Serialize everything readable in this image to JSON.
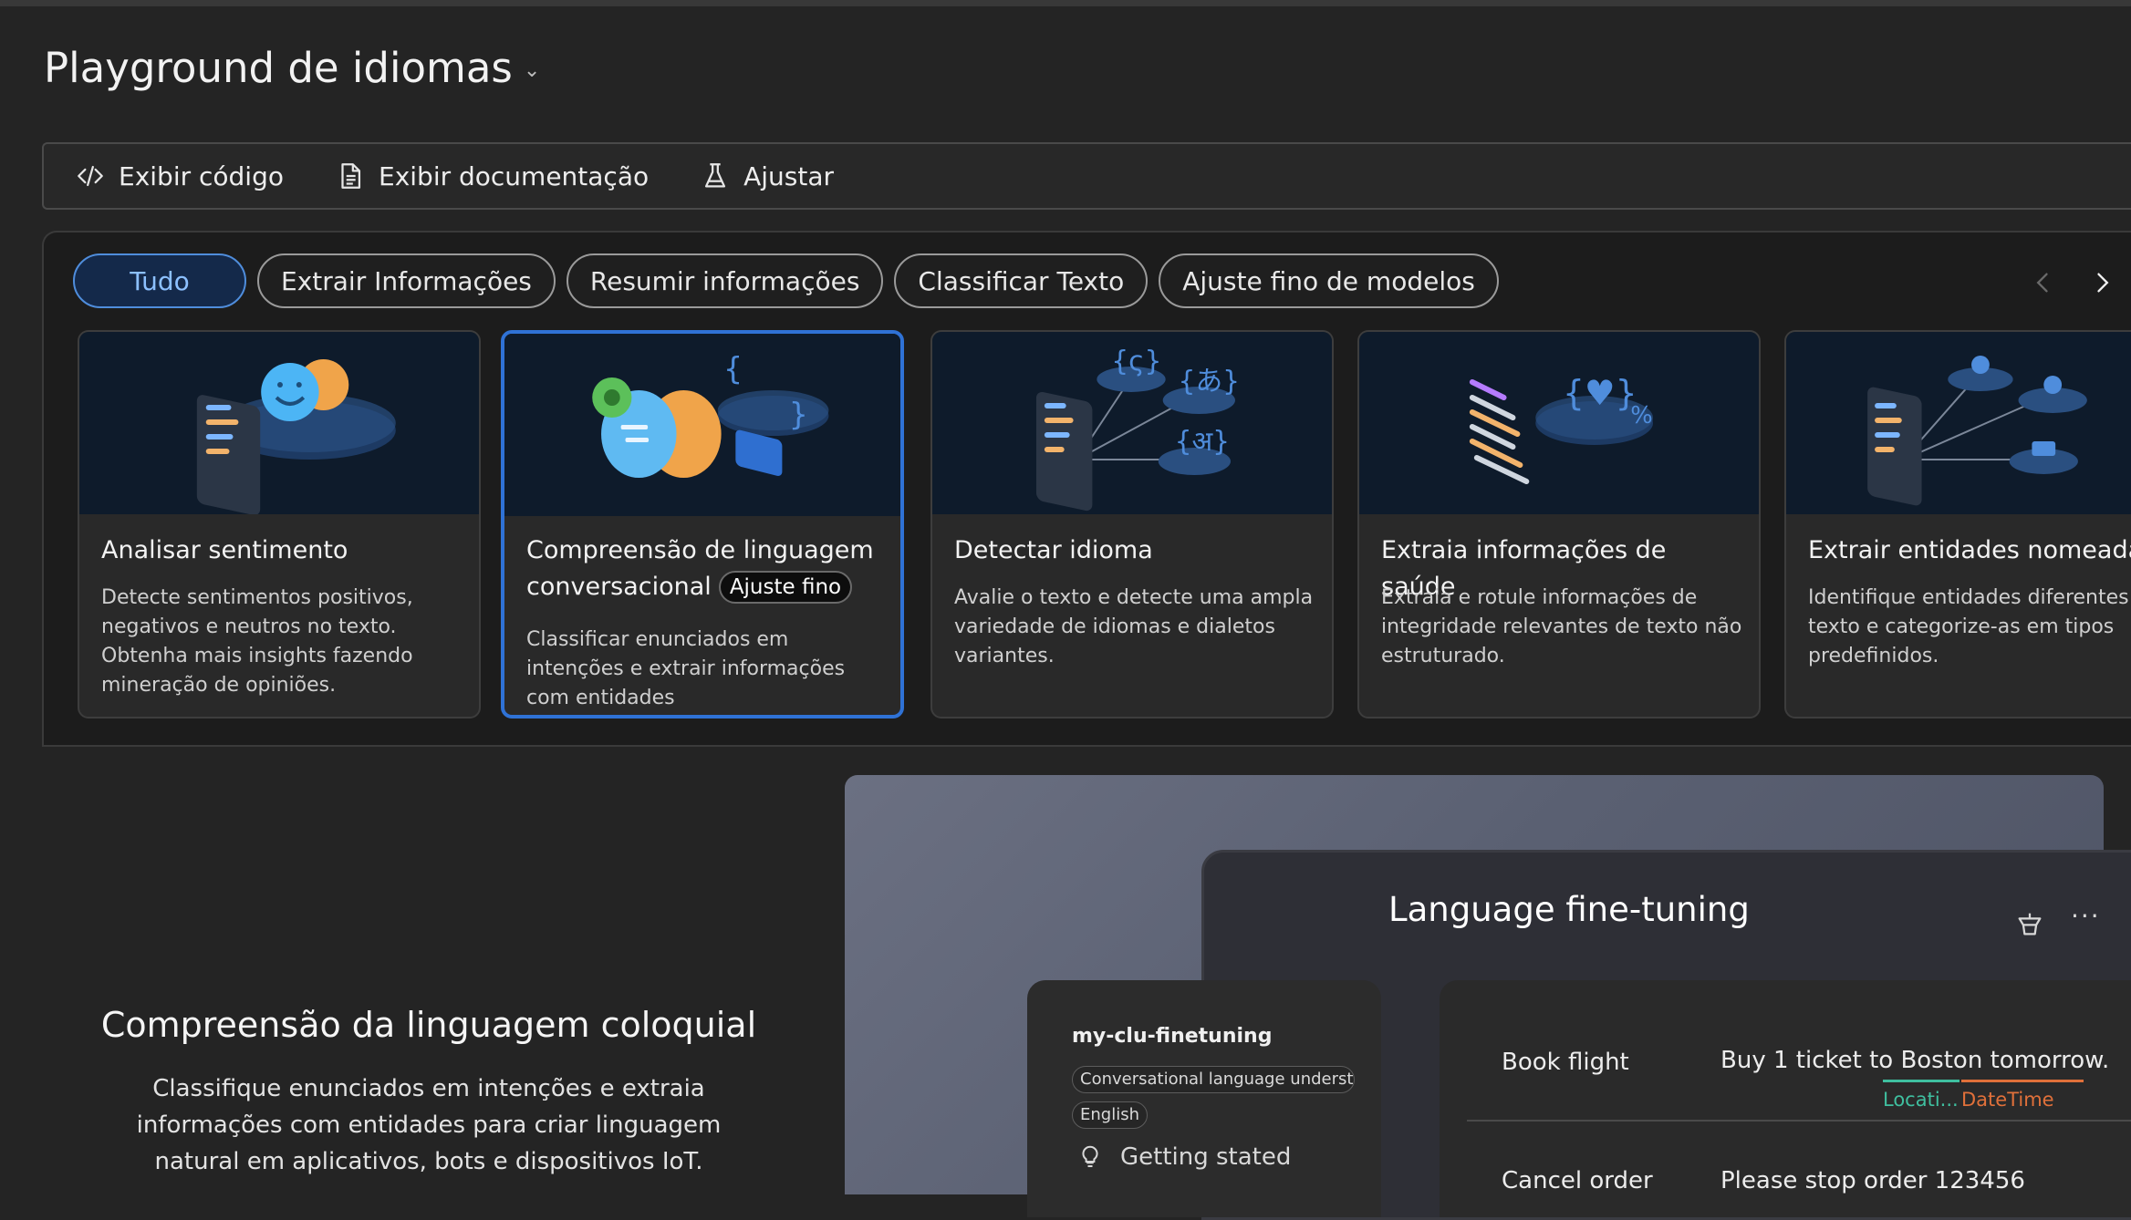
{
  "page": {
    "title": "Playground de idiomas"
  },
  "toolbar": {
    "view_code": "Exibir código",
    "view_docs": "Exibir documentação",
    "tune": "Ajustar"
  },
  "filters": [
    "Tudo",
    "Extrair Informações",
    "Resumir informações",
    "Classificar Texto",
    "Ajuste fino de modelos"
  ],
  "cards": [
    {
      "title": "Analisar sentimento",
      "desc": "Detecte sentimentos positivos, negativos e neutros no texto. Obtenha mais insights fazendo mineração de opiniões."
    },
    {
      "title": "Compreensão de linguagem conversacional",
      "badge": "Ajuste fino",
      "desc": "Classificar enunciados em intenções e extrair informações com entidades"
    },
    {
      "title": "Detectar idioma",
      "desc": "Avalie o texto e detecte uma ampla variedade de idiomas e dialetos variantes."
    },
    {
      "title": "Extraia informações de saúde",
      "desc": "Extraia e rotule informações de integridade relevantes de texto não estruturado."
    },
    {
      "title": "Extrair entidades nomeadas",
      "desc": "Identifique entidades diferentes no texto e categorize-as em tipos predefinidos."
    }
  ],
  "hero": {
    "title": "Compreensão da linguagem coloquial",
    "desc": "Classifique enunciados em intenções e extraia informações com entidades para criar linguagem natural em aplicativos, bots e dispositivos IoT."
  },
  "preview": {
    "title": "Language fine-tuning",
    "more": "···",
    "project": "my-clu-finetuning",
    "tags": [
      "Conversational language understanding",
      "English"
    ],
    "status": "Getting stated",
    "rows": [
      {
        "intent": "Book flight",
        "utterance": "Buy 1 ticket to Boston tomorrow.",
        "entities": [
          "Locati...",
          "DateTime"
        ]
      },
      {
        "intent": "Cancel order",
        "utterance": "Please stop order 123456"
      }
    ]
  },
  "colors": {
    "accent": "#2f72d6",
    "location_entity": "#3fbf9f",
    "datetime_entity": "#e0703a"
  }
}
